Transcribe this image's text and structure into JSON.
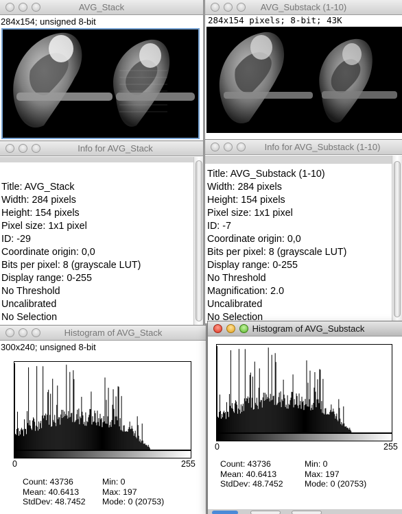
{
  "windows": {
    "avg_stack": {
      "title": "AVG_Stack",
      "subtitle": "284x154; unsigned 8-bit"
    },
    "avg_substack": {
      "title": "AVG_Substack (1-10)",
      "subtitle": "284x154 pixels; 8-bit; 43K"
    },
    "info_stack": {
      "title": "Info for AVG_Stack",
      "lines": [
        "Title: AVG_Stack",
        "Width:  284 pixels",
        "Height:  154 pixels",
        "Pixel size: 1x1 pixel",
        "ID: -29",
        "Coordinate origin:  0,0",
        "Bits per pixel: 8 (grayscale LUT)",
        "Display range: 0-255",
        "No Threshold",
        "Uncalibrated",
        "No Selection"
      ]
    },
    "info_substack": {
      "title": "Info for AVG_Substack (1-10)",
      "lines": [
        "Title: AVG_Substack (1-10)",
        "Width:  284 pixels",
        "Height:  154 pixels",
        "Pixel size: 1x1 pixel",
        "ID: -7",
        "Coordinate origin:  0,0",
        "Bits per pixel: 8 (grayscale LUT)",
        "Display range: 0-255",
        "No Threshold",
        "Magnification: 2.0",
        "Uncalibrated",
        "No Selection"
      ]
    },
    "hist_stack": {
      "title": "Histogram of AVG_Stack",
      "subtitle": "300x240; unsigned 8-bit",
      "axis_min": "0",
      "axis_max": "255",
      "stats_left": [
        "Count: 43736",
        "Mean: 40.6413",
        "StdDev: 48.7452"
      ],
      "stats_right": [
        "Min: 0",
        "Max: 197",
        "Mode: 0 (20753)"
      ]
    },
    "hist_substack": {
      "title": "Histogram of AVG_Substack",
      "axis_min": "0",
      "axis_max": "255",
      "stats_left": [
        "Count: 43736",
        "Mean: 40.6413",
        "StdDev: 48.7452"
      ],
      "stats_right": [
        "Min: 0",
        "Max: 197",
        "Mode: 0 (20753)"
      ]
    }
  },
  "histogram": {
    "bins": 256,
    "min": 0,
    "max": 197,
    "mode": 0,
    "mode_count": 20753,
    "colors": {
      "bar": "#000000",
      "frame": "#000000",
      "red_light": "#e0331f",
      "yellow_light": "#e3a21a",
      "green_light": "#5bb52c"
    }
  }
}
